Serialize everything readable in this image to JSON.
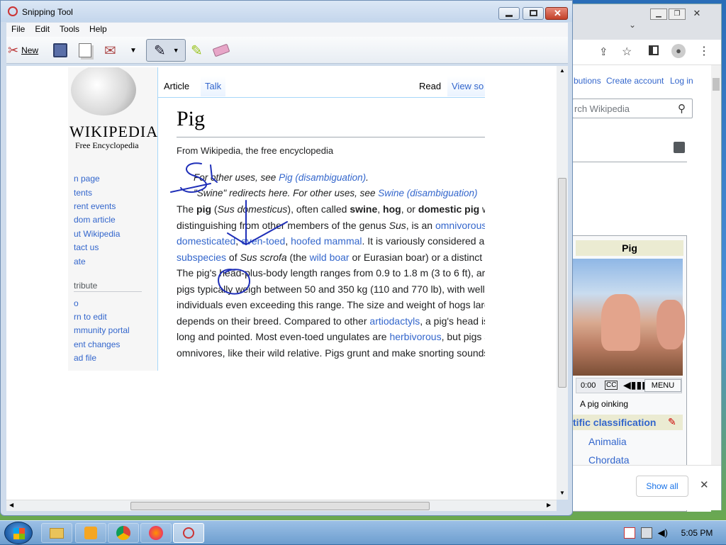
{
  "snipping": {
    "title": "Snipping Tool",
    "menu": [
      "File",
      "Edit",
      "Tools",
      "Help"
    ],
    "new_label": "New"
  },
  "wiki": {
    "logo_title": "WIKIPEDIA",
    "logo_sub": "Free Encyclopedia",
    "nav": [
      "n page",
      "tents",
      "rent events",
      "dom article",
      "ut Wikipedia",
      "tact us",
      "ate"
    ],
    "contribute_heading": "tribute",
    "contribute": [
      "o",
      "rn to edit",
      "mmunity portal",
      "ent changes",
      "ad file"
    ],
    "tab_article": "Article",
    "tab_talk": "Talk",
    "tab_read": "Read",
    "tab_view": "View so",
    "title": "Pig",
    "from": "From Wikipedia, the free encyclopedia",
    "hatnote1_pre": "For other uses, see ",
    "hatnote1_link": "Pig (disambiguation)",
    "hatnote1_post": ".",
    "hatnote2_pre": "\"Swine\" redirects here. For other uses, see ",
    "hatnote2_link": "Swine (disambiguation)",
    "lines": [
      [
        "The ",
        "pig",
        " (",
        "Sus domesticus",
        "), often called ",
        "swine",
        ", ",
        "hog",
        ", or ",
        "domestic pig",
        " w"
      ],
      [
        "distinguishing from other members of the genus ",
        "Sus",
        ", is an ",
        "omnivorous"
      ],
      [
        "domesticated",
        ", ",
        "even-toed",
        ", ",
        "hoofed mammal",
        ". It is variously considered a"
      ],
      [
        "subspecies",
        " of ",
        "Sus scrofa",
        " (the ",
        "wild boar",
        " or Eurasian boar) or a distinct"
      ],
      [
        "The pig's head-plus-body length ranges from 0.9 to 1.8 m (3 to 6 ft), ar"
      ],
      [
        "pigs typically weigh between 50 and 350 kg (110 and 770 lb), with well-"
      ],
      [
        "individuals even exceeding this range. The size and weight of hogs larg"
      ],
      [
        "depends on their breed. Compared to other ",
        "artiodactyls",
        ", a pig's head is"
      ],
      [
        "long and pointed. Most even-toed ungulates are ",
        "herbivorous",
        ", but pigs a"
      ],
      [
        "omnivores, like their wild relative. Pigs grunt and make snorting sounds"
      ]
    ]
  },
  "chrome": {
    "contrib": "butions",
    "create_account": "Create account",
    "login": "Log in",
    "search_placeholder": "rch Wikipedia",
    "infobox_title": "Pig",
    "time": "0:00",
    "menu_btn": "MENU",
    "caption": "A pig oinking",
    "classification": "tific classification",
    "kingdom": "Animalia",
    "phylum": "Chordata",
    "show_all": "Show all"
  },
  "taskbar": {
    "clock": "5:05 PM"
  },
  "colors": {
    "link": "#3366cc",
    "ink": "#1f2fb8"
  }
}
